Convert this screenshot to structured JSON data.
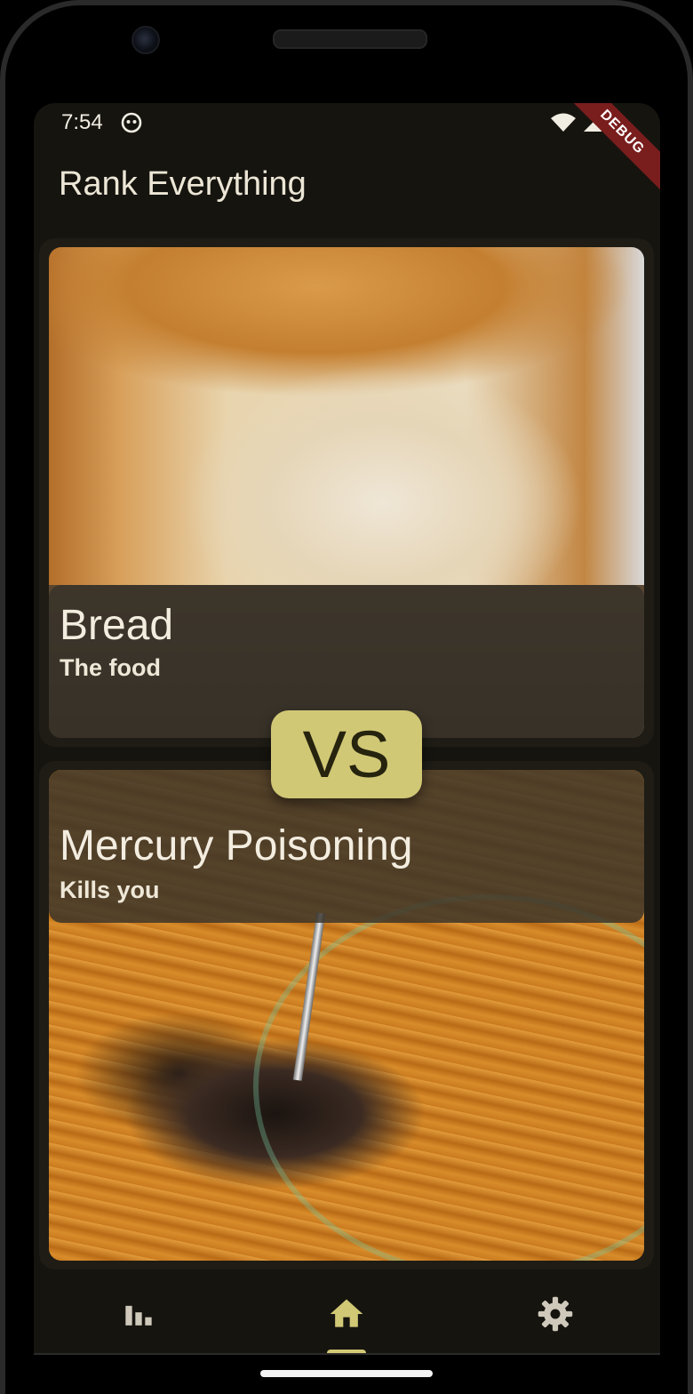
{
  "status_bar": {
    "time": "7:54",
    "debug_label": "DEBUG"
  },
  "app_bar": {
    "title": "Rank Everything"
  },
  "matchup": {
    "top_item": {
      "title": "Bread",
      "subtitle": "The food",
      "image": "bread-photo"
    },
    "vs_label": "VS",
    "bottom_item": {
      "title": "Mercury Poisoning",
      "subtitle": "Kills you",
      "image": "mercury-photo"
    }
  },
  "bottom_nav": {
    "items": [
      {
        "icon": "leaderboard-icon",
        "selected": false
      },
      {
        "icon": "home-icon",
        "selected": true
      },
      {
        "icon": "settings-icon",
        "selected": false
      }
    ],
    "accent_color": "#d1c876",
    "icon_color": "#cfc9bb"
  },
  "colors": {
    "background": "#16140f",
    "card": "#1e1c15",
    "accent": "#d1c876",
    "debug_ribbon": "#7a1d1d"
  }
}
